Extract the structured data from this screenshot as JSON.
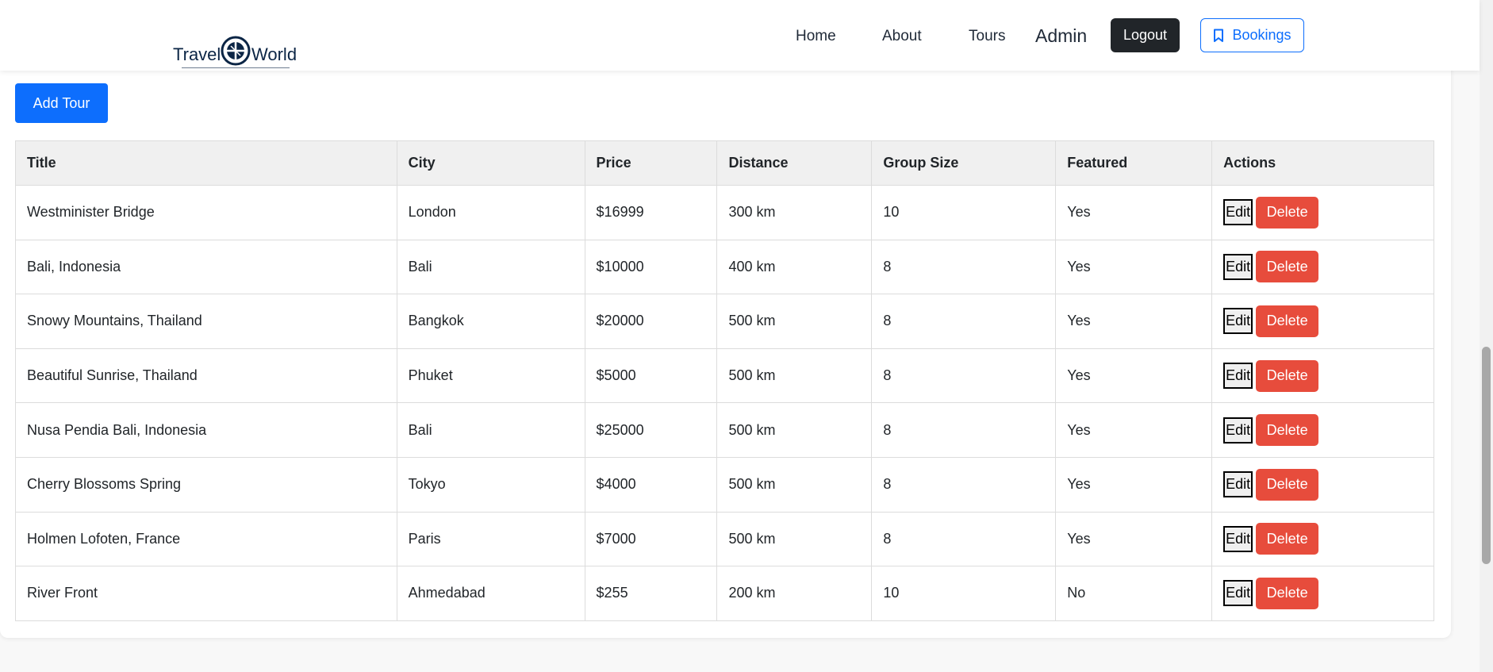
{
  "brand": {
    "name_left": "Travel",
    "name_right": "World"
  },
  "nav": {
    "home": "Home",
    "about": "About",
    "tours": "Tours",
    "admin": "Admin",
    "logout": "Logout",
    "bookings": "Bookings",
    "bookings_icon": "bookmark-icon"
  },
  "actions": {
    "add_tour": "Add Tour"
  },
  "table": {
    "headers": [
      "Title",
      "City",
      "Price",
      "Distance",
      "Group Size",
      "Featured",
      "Actions"
    ],
    "edit_label": "Edit",
    "delete_label": "Delete",
    "rows": [
      {
        "title": "Westminister Bridge",
        "city": "London",
        "price": "$16999",
        "distance": "300 km",
        "group_size": "10",
        "featured": "Yes"
      },
      {
        "title": "Bali, Indonesia",
        "city": "Bali",
        "price": "$10000",
        "distance": "400 km",
        "group_size": "8",
        "featured": "Yes"
      },
      {
        "title": "Snowy Mountains, Thailand",
        "city": "Bangkok",
        "price": "$20000",
        "distance": "500 km",
        "group_size": "8",
        "featured": "Yes"
      },
      {
        "title": "Beautiful Sunrise, Thailand",
        "city": "Phuket",
        "price": "$5000",
        "distance": "500 km",
        "group_size": "8",
        "featured": "Yes"
      },
      {
        "title": "Nusa Pendia Bali, Indonesia",
        "city": "Bali",
        "price": "$25000",
        "distance": "500 km",
        "group_size": "8",
        "featured": "Yes"
      },
      {
        "title": "Cherry Blossoms Spring",
        "city": "Tokyo",
        "price": "$4000",
        "distance": "500 km",
        "group_size": "8",
        "featured": "Yes"
      },
      {
        "title": "Holmen Lofoten, France",
        "city": "Paris",
        "price": "$7000",
        "distance": "500 km",
        "group_size": "8",
        "featured": "Yes"
      },
      {
        "title": "River Front",
        "city": "Ahmedabad",
        "price": "$255",
        "distance": "200 km",
        "group_size": "10",
        "featured": "No"
      }
    ]
  },
  "colors": {
    "primary": "#0d6efd",
    "danger": "#e74c3c",
    "dark": "#212529",
    "header_bg": "#f0f0f0"
  }
}
